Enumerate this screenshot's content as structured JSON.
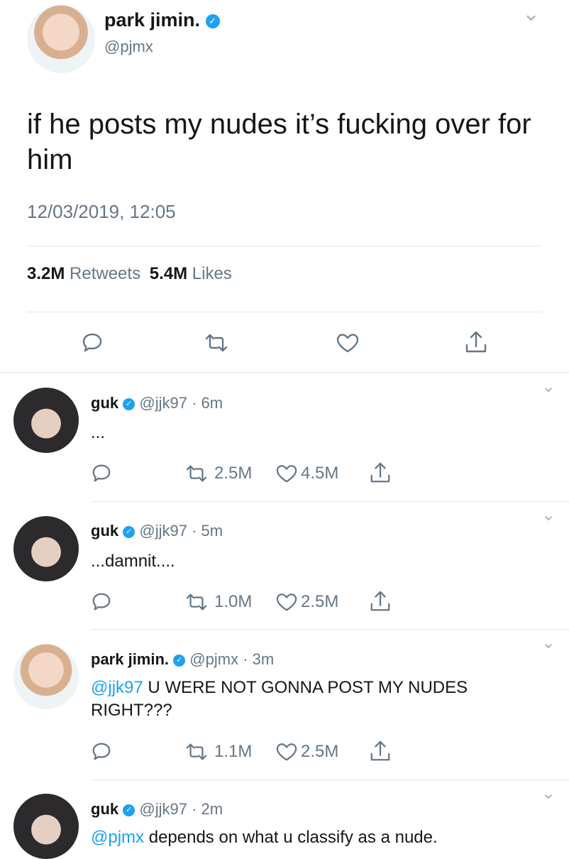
{
  "main_tweet": {
    "name": "park jimin.",
    "handle": "@pjmx",
    "text": "if he posts my nudes it’s fucking over for him",
    "timestamp": "12/03/2019, 12:05",
    "retweets_count": "3.2M",
    "retweets_label": "Retweets",
    "likes_count": "5.4M",
    "likes_label": "Likes"
  },
  "replies": [
    {
      "name": "guk",
      "handle": "@jjk97",
      "sep": "·",
      "time": "6m",
      "mention": "",
      "text": "...",
      "retweets": "2.5M",
      "likes": "4.5M"
    },
    {
      "name": "guk",
      "handle": "@jjk97",
      "sep": "·",
      "time": "5m",
      "mention": "",
      "text": "...damnit....",
      "retweets": "1.0M",
      "likes": "2.5M"
    },
    {
      "name": "park jimin.",
      "handle": "@pjmx",
      "sep": "·",
      "time": "3m",
      "mention": "@jjk97",
      "text": " U WERE NOT GONNA POST MY NUDES RIGHT???",
      "retweets": "1.1M",
      "likes": "2.5M"
    },
    {
      "name": "guk",
      "handle": "@jjk97",
      "sep": "·",
      "time": "2m",
      "mention": "@pjmx",
      "text": " depends on what u classify as a nude.",
      "retweets": "",
      "likes": ""
    }
  ],
  "icons": {
    "verified": "✓",
    "chevron": "⌄"
  },
  "colors": {
    "accent": "#1da1f2",
    "muted": "#657786",
    "divider": "#e1e8ed"
  }
}
